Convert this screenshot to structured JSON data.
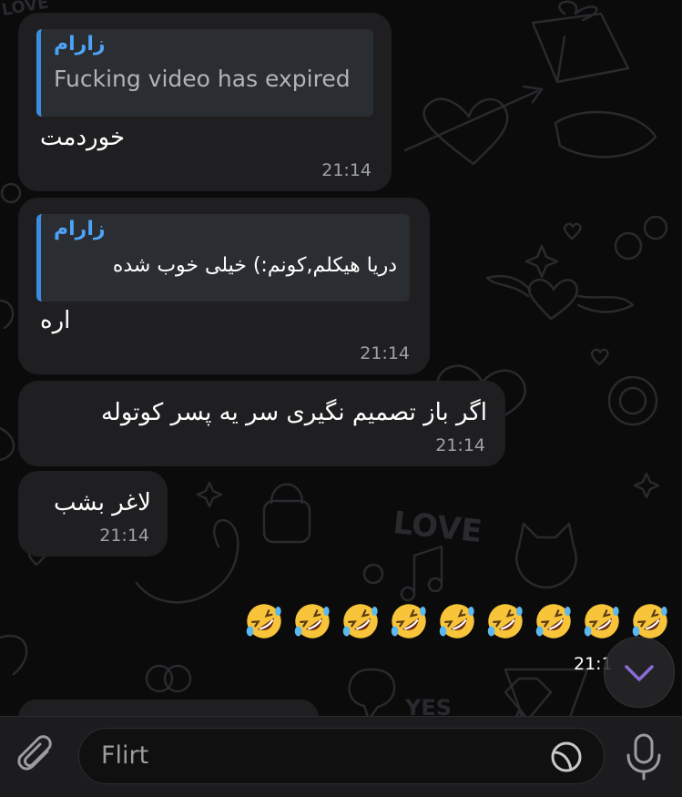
{
  "messages": [
    {
      "reply_name": "زارام",
      "reply_text": "Fucking video has expired",
      "text": "خوردمت",
      "time": "21:14"
    },
    {
      "reply_name": "زارام",
      "reply_text": "دریا هیکلم,کونم:) خیلی خوب شده",
      "text": "اره",
      "time": "21:14"
    },
    {
      "text": "اگر باز تصمیم نگیری سر یه پسر کوتوله",
      "time": "21:14"
    },
    {
      "text": "لاغر بشب",
      "time": "21:14"
    }
  ],
  "outgoing": {
    "emoji": "rolling-on-the-floor-laughing",
    "emoji_count": 9,
    "time": "21:1"
  },
  "wallpaper_text": [
    "LOVE",
    "LOVE",
    "YES"
  ],
  "input": {
    "placeholder": "Flirt"
  },
  "colors": {
    "background": "#0b0b0c",
    "bubble": "#1f1f21",
    "reply_accent": "#3c8de0",
    "reply_name": "#4da3f5",
    "scroll_button_chevron": "#8a6cd6"
  },
  "icons": [
    "paperclip-icon",
    "sticker-icon",
    "microphone-icon",
    "chevron-down-icon"
  ]
}
